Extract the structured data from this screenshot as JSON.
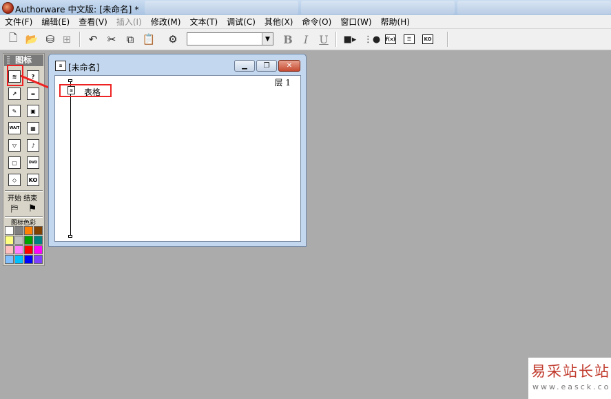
{
  "window": {
    "title": "Authorware 中文版: [未命名] *"
  },
  "menubar": {
    "items": [
      {
        "label": "文件(F)"
      },
      {
        "label": "编辑(E)"
      },
      {
        "label": "查看(V)"
      },
      {
        "label": "插入(I)",
        "disabled": true
      },
      {
        "label": "修改(M)"
      },
      {
        "label": "文本(T)"
      },
      {
        "label": "调试(C)"
      },
      {
        "label": "其他(X)"
      },
      {
        "label": "命令(O)"
      },
      {
        "label": "窗口(W)"
      },
      {
        "label": "帮助(H)"
      }
    ]
  },
  "toolbar": {
    "font_combo_value": "",
    "bold_label": "B",
    "italic_label": "I",
    "underline_label": "U",
    "icons": [
      "new-file-icon",
      "open-folder-icon",
      "import-icon",
      "save-icon",
      "undo-icon",
      "cut-icon",
      "copy-icon",
      "paste-icon",
      "find-icon",
      "run-icon",
      "control-panel-icon",
      "functions-icon",
      "variables-icon",
      "knowledge-objects-icon"
    ]
  },
  "icon_palette": {
    "title": "图标",
    "start_end_label": "开始 结束",
    "color_label": "图标色彩",
    "icons": [
      {
        "name": "display-icon",
        "glyph": "≋"
      },
      {
        "name": "interaction-icon",
        "glyph": "?"
      },
      {
        "name": "motion-icon",
        "glyph": "↗"
      },
      {
        "name": "calculation-icon",
        "glyph": "="
      },
      {
        "name": "erase-icon",
        "glyph": "✎"
      },
      {
        "name": "map-icon",
        "glyph": "▣"
      },
      {
        "name": "wait-icon",
        "glyph": "WAIT"
      },
      {
        "name": "movie-icon",
        "glyph": "▦"
      },
      {
        "name": "navigate-icon",
        "glyph": "▽"
      },
      {
        "name": "sound-icon",
        "glyph": "♪"
      },
      {
        "name": "framework-icon",
        "glyph": "▢"
      },
      {
        "name": "dvd-icon",
        "glyph": "DVD"
      },
      {
        "name": "decision-icon",
        "glyph": "◇"
      },
      {
        "name": "knowledge-object-icon",
        "glyph": "KO"
      }
    ],
    "colors": [
      "#ffffff",
      "#808080",
      "#ff8000",
      "#804000",
      "#ffff80",
      "#c0c0c0",
      "#00a000",
      "#008080",
      "#ffc0c0",
      "#ff80ff",
      "#ff0000",
      "#ff00ff",
      "#80c0ff",
      "#00c0ff",
      "#0000ff",
      "#8040ff"
    ]
  },
  "flowline_window": {
    "title": "[未命名]",
    "layer_label": "层 1",
    "item_label": "表格"
  },
  "watermark": {
    "main": "易采站长站",
    "sub": "www.easck.com"
  }
}
